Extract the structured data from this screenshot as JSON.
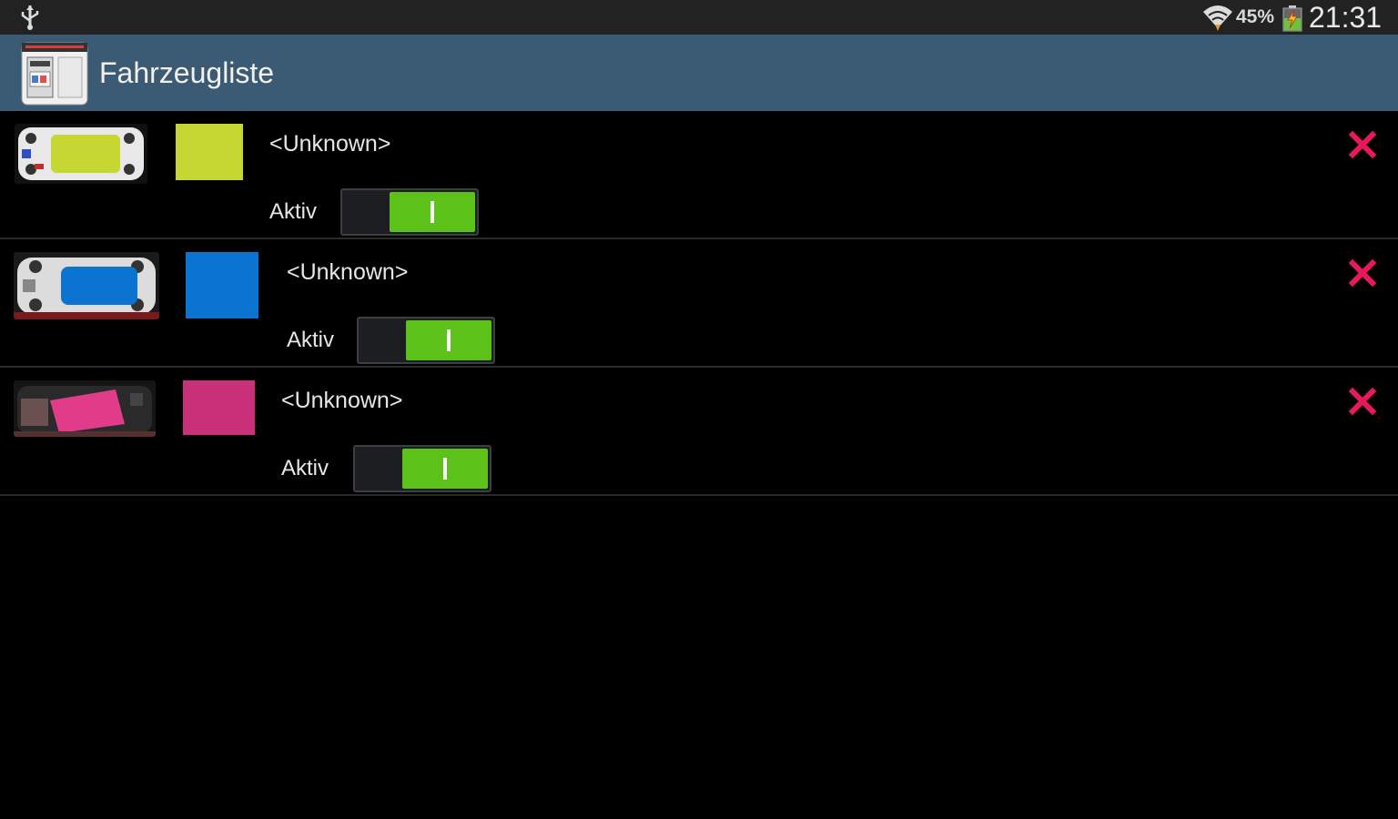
{
  "status_bar": {
    "icons": [
      "usb-icon",
      "wifi-icon",
      "battery-charging-icon"
    ],
    "battery": "45%",
    "time": "21:31"
  },
  "action_bar": {
    "title": "Fahrzeugliste",
    "icon": "app-icon"
  },
  "vehicles": [
    {
      "name": "<Unknown>",
      "status_label": "Aktiv",
      "active": true,
      "color": "#c6d733"
    },
    {
      "name": "<Unknown>",
      "status_label": "Aktiv",
      "active": true,
      "color": "#0a74d0"
    },
    {
      "name": "<Unknown>",
      "status_label": "Aktiv",
      "active": true,
      "color": "#c8307a"
    }
  ],
  "colors": {
    "status_bar": "#222222",
    "action_bar": "#3b5a74",
    "switch_on": "#5cc21a",
    "delete": "#e8185a"
  }
}
